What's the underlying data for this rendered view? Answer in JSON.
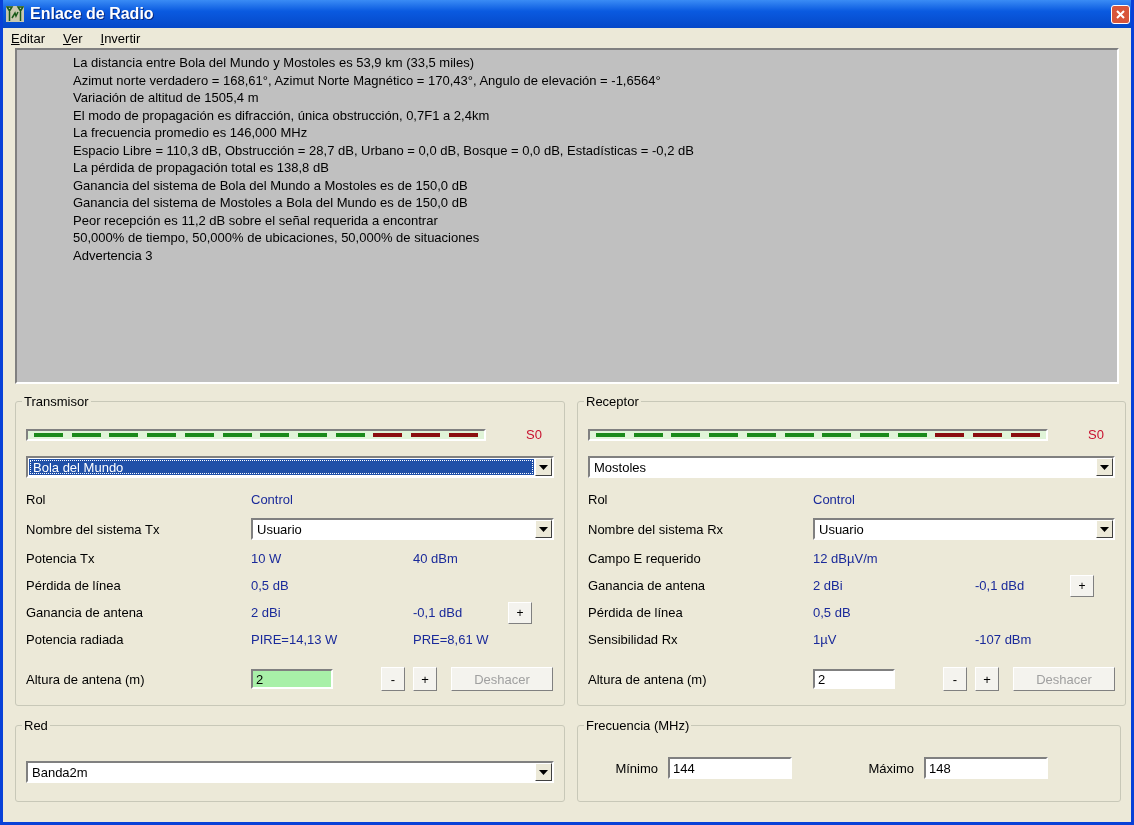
{
  "window": {
    "title": "Enlace de Radio"
  },
  "menu": [
    {
      "label": "Editar"
    },
    {
      "label": "Ver"
    },
    {
      "label": "Invertir"
    }
  ],
  "report": {
    "lines": [
      "La distancia entre Bola del Mundo y Mostoles es 53,9 km (33,5 miles)",
      "Azimut norte verdadero = 168,61°, Azimut Norte Magnético = 170,43°, Angulo de elevación = -1,6564°",
      "Variación de altitud de 1505,4 m",
      "El modo de propagación es difracción, única obstrucción, 0,7F1 a 2,4km",
      "La frecuencia promedio es 146,000 MHz",
      "Espacio Libre = 110,3 dB, Obstrucción = 28,7 dB, Urbano = 0,0 dB, Bosque = 0,0 dB, Estadísticas = -0,2 dB",
      "La pérdida de propagación total es 138,8 dB",
      "Ganancia del sistema de Bola del Mundo a Mostoles es de 150,0 dB",
      "Ganancia del sistema de Mostoles a Bola del Mundo es de 150,0 dB",
      "Peor recepción es 11,2 dB sobre el señal requerida a encontrar",
      "50,000% de tiempo, 50,000% de ubicaciones, 50,000% de situaciones",
      "Advertencia 3"
    ]
  },
  "panels": [
    {
      "title": "Transmisor",
      "reading": "S0",
      "site": {
        "value": "Bola del Mundo",
        "focused": true
      },
      "rows": [
        {
          "kind": "values",
          "label": "Rol",
          "values": [
            "Control"
          ]
        },
        {
          "kind": "select",
          "label": "Nombre del sistema Tx",
          "value": "Usuario"
        },
        {
          "kind": "values",
          "label": "Potencia Tx",
          "values": [
            "10 W",
            "40 dBm"
          ]
        },
        {
          "kind": "values",
          "label": "Pérdida de línea",
          "values": [
            "0,5 dB"
          ]
        },
        {
          "kind": "values",
          "label": "Ganancia de antena",
          "values": [
            "2 dBi",
            "-0,1 dBd"
          ],
          "button": "+"
        },
        {
          "kind": "values",
          "label": "Potencia radiada",
          "values": [
            "PIRE=14,13 W",
            "PRE=8,61 W"
          ]
        }
      ],
      "height": {
        "label": "Altura de antena (m)",
        "value": "2",
        "highlighted": true,
        "buttons": [
          {
            "label": "-",
            "disabled": false
          },
          {
            "label": "+",
            "disabled": false
          },
          {
            "label": "Deshacer",
            "disabled": true
          }
        ]
      }
    },
    {
      "title": "Receptor",
      "reading": "S0",
      "site": {
        "value": "Mostoles",
        "focused": false
      },
      "rows": [
        {
          "kind": "values",
          "label": "Rol",
          "values": [
            "Control"
          ]
        },
        {
          "kind": "select",
          "label": "Nombre del sistema Rx",
          "value": "Usuario"
        },
        {
          "kind": "values",
          "label": "Campo E requerido",
          "values": [
            "12 dBµV/m"
          ]
        },
        {
          "kind": "values",
          "label": "Ganancia de antena",
          "values": [
            "2 dBi",
            "-0,1 dBd"
          ],
          "button": "+"
        },
        {
          "kind": "values",
          "label": "Pérdida de línea",
          "values": [
            "0,5 dB"
          ]
        },
        {
          "kind": "values",
          "label": "Sensibilidad Rx",
          "values": [
            "1µV",
            "-107 dBm"
          ]
        }
      ],
      "height": {
        "label": "Altura de antena (m)",
        "value": "2",
        "highlighted": false,
        "buttons": [
          {
            "label": "-",
            "disabled": false
          },
          {
            "label": "+",
            "disabled": false
          },
          {
            "label": "Deshacer",
            "disabled": true
          }
        ]
      }
    }
  ],
  "network": {
    "title": "Red",
    "value": "Banda2m"
  },
  "frequency": {
    "title": "Frecuencia (MHz)",
    "fields": [
      {
        "label": "Mínimo",
        "value": "144"
      },
      {
        "label": "Máximo",
        "value": "148"
      }
    ]
  }
}
